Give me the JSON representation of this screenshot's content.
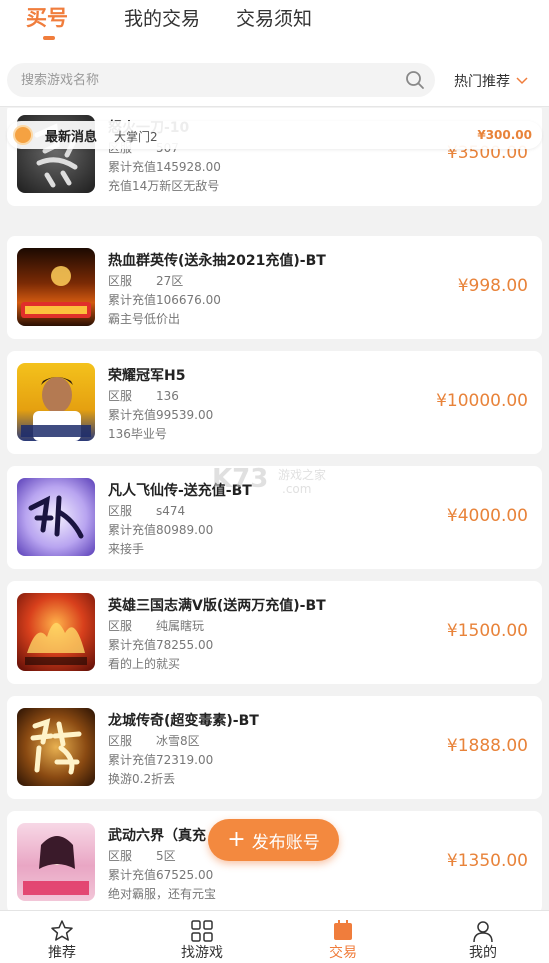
{
  "tabs": [
    "买号",
    "我的交易",
    "交易须知"
  ],
  "search": {
    "placeholder": "搜索游戏名称"
  },
  "sort_label": "热门推荐",
  "notice": {
    "title": "最新消息",
    "text": "大掌门2",
    "price": "¥300.00"
  },
  "listings": [
    {
      "name": "怒火一刀-10",
      "server_label": "区服",
      "server": "507",
      "recharge_label": "累计充值",
      "recharge": "145928.00",
      "desc": "充值14万新区无敌号",
      "price": "¥3500.00"
    },
    {
      "name": "热血群英传(送永抽2021充值)-BT",
      "server_label": "区服",
      "server": "27区",
      "recharge_label": "累计充值",
      "recharge": "106676.00",
      "desc": "霸主号低价出",
      "price": "¥998.00"
    },
    {
      "name": "荣耀冠军H5",
      "server_label": "区服",
      "server": "136",
      "recharge_label": "累计充值",
      "recharge": "99539.00",
      "desc": "136毕业号",
      "price": "¥10000.00"
    },
    {
      "name": "凡人飞仙传-送充值-BT",
      "server_label": "区服",
      "server": "s474",
      "recharge_label": "累计充值",
      "recharge": "80989.00",
      "desc": "来接手",
      "price": "¥4000.00"
    },
    {
      "name": "英雄三国志满V版(送两万充值)-BT",
      "server_label": "区服",
      "server": "纯属瞎玩",
      "recharge_label": "累计充值",
      "recharge": "78255.00",
      "desc": "看的上的就买",
      "price": "¥1500.00"
    },
    {
      "name": "龙城传奇(超变毒素)-BT",
      "server_label": "区服",
      "server": "冰雪8区",
      "recharge_label": "累计充值",
      "recharge": "72319.00",
      "desc": "换游0.2折丢",
      "price": "¥1888.00"
    },
    {
      "name": "武动六界（真充",
      "server_label": "区服",
      "server": "5区",
      "recharge_label": "累计充值",
      "recharge": "67525.00",
      "desc": "绝对霸服，还有元宝",
      "price": "¥1350.00"
    }
  ],
  "publish_label": "发布账号",
  "watermark": {
    "text": "K73",
    "sub1": "游戏之家",
    "sub2": ".com"
  },
  "nav": [
    "推荐",
    "找游戏",
    "交易",
    "我的"
  ],
  "colors": {
    "accent": "#f07d3c",
    "price": "#e8833a"
  }
}
